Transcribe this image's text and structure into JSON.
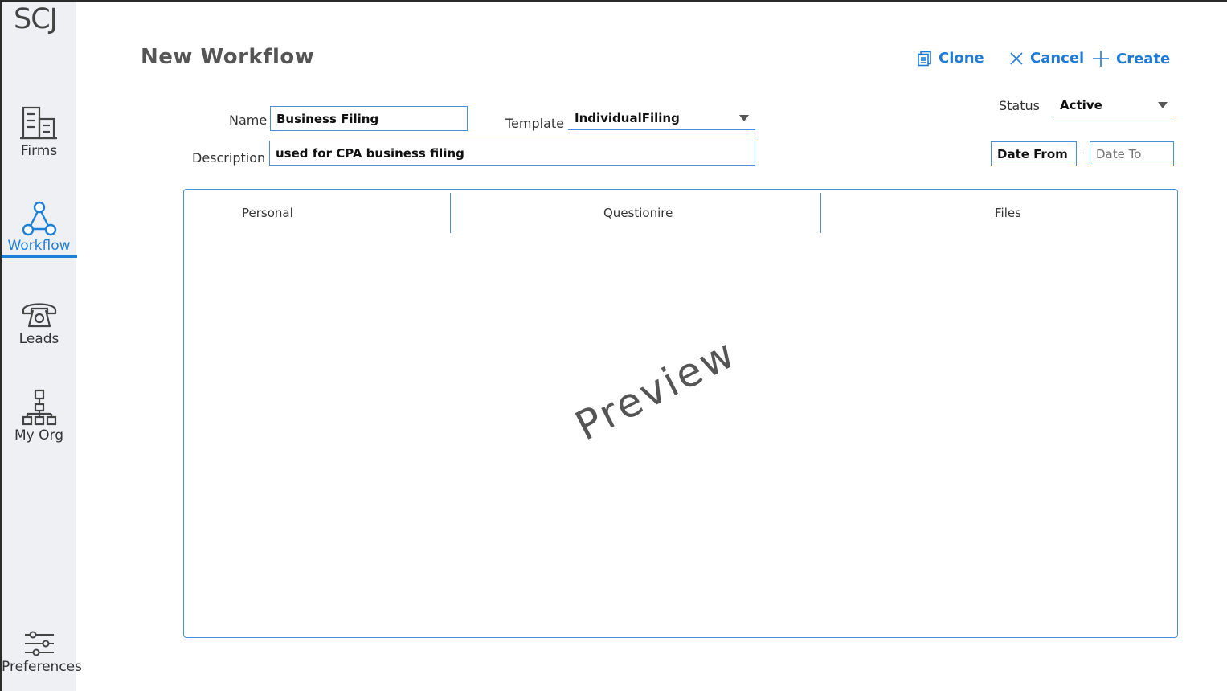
{
  "app": {
    "logo": "SCJ"
  },
  "sidebar": {
    "items": [
      {
        "label": "Firms",
        "icon": "building-icon"
      },
      {
        "label": "Workflow",
        "icon": "workflow-icon",
        "active": true
      },
      {
        "label": "Leads",
        "icon": "phone-icon"
      },
      {
        "label": "My Org",
        "icon": "org-chart-icon"
      }
    ],
    "footer": {
      "label": "Preferences",
      "icon": "sliders-icon"
    }
  },
  "header": {
    "title": "New Workflow",
    "actions": {
      "clone": "Clone",
      "cancel": "Cancel",
      "create": "Create"
    }
  },
  "form": {
    "name_label": "Name",
    "name_value": "Business Filing",
    "template_label": "Template",
    "template_value": "IndividualFiling",
    "description_label": "Description",
    "description_value": "used for CPA business filing",
    "status_label": "Status",
    "status_value": "Active",
    "date_from_value": "Date From",
    "date_separator": "-",
    "date_to_placeholder": "Date To"
  },
  "preview": {
    "columns": [
      "Personal",
      "Questionire",
      "Files"
    ],
    "watermark": "Preview"
  },
  "colors": {
    "accent": "#1e7fd6",
    "sidebar_bg": "#eef0f4",
    "border": "#4a90d9"
  }
}
